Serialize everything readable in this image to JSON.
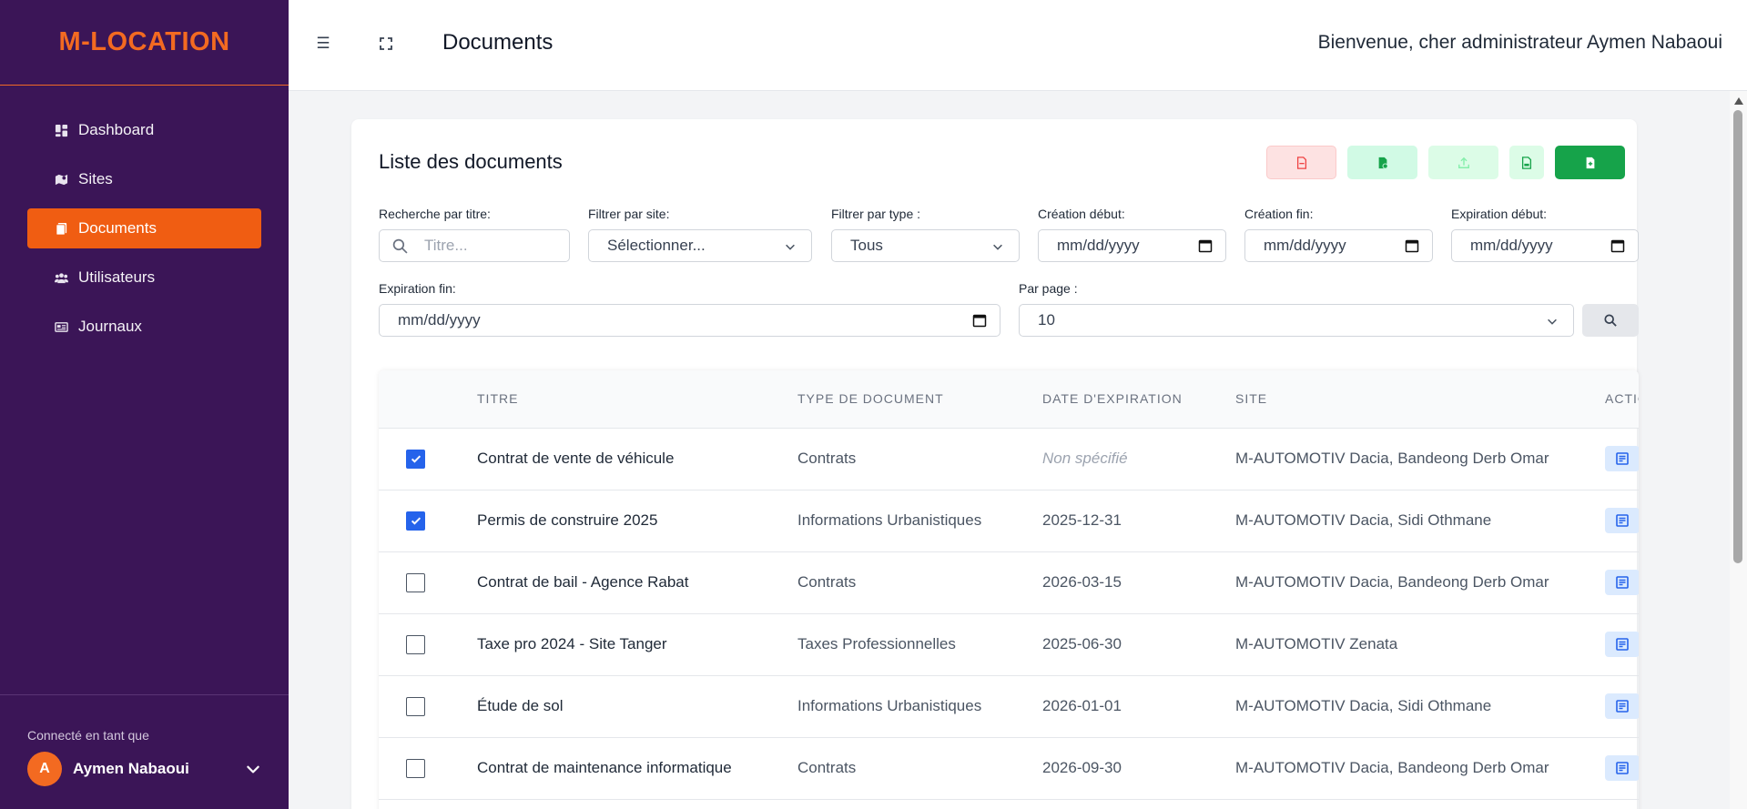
{
  "sidebar": {
    "brand": "M-LOCATION",
    "items": [
      {
        "label": "Dashboard",
        "icon": "dashboard-icon"
      },
      {
        "label": "Sites",
        "icon": "map-icon"
      },
      {
        "label": "Documents",
        "icon": "documents-icon",
        "active": true
      },
      {
        "label": "Utilisateurs",
        "icon": "users-icon"
      },
      {
        "label": "Journaux",
        "icon": "journal-icon"
      }
    ],
    "connected_label": "Connecté en tant que",
    "user_initial": "A",
    "user_name": "Aymen Nabaoui"
  },
  "header": {
    "menu_icon": "☰",
    "page_title": "Documents",
    "welcome": "Bienvenue, cher administrateur Aymen Nabaoui"
  },
  "card": {
    "title": "Liste des documents"
  },
  "filters": {
    "title_label": "Recherche par titre:",
    "title_placeholder": "Titre...",
    "site_label": "Filtrer par site:",
    "site_value": "Sélectionner...",
    "type_label": "Filtrer par type :",
    "type_value": "Tous",
    "creation_start_label": "Création début:",
    "creation_start_value": "mm/dd/yyyy",
    "creation_end_label": "Création fin:",
    "creation_end_value": "mm/dd/yyyy",
    "expiration_start_label": "Expiration début:",
    "expiration_start_value": "mm/dd/yyyy",
    "expiration_end_label": "Expiration fin:",
    "expiration_end_value": "mm/dd/yyyy",
    "per_page_label": "Par page :",
    "per_page_value": "10"
  },
  "table": {
    "columns": [
      "TITRE",
      "TYPE DE DOCUMENT",
      "DATE D'EXPIRATION",
      "SITE",
      "ACTIONS"
    ],
    "rows": [
      {
        "checked": true,
        "title": "Contrat de vente de véhicule",
        "type": "Contrats",
        "expiration": "Non spécifié",
        "site": "M-AUTOMOTIV Dacia, Bandeong Derb Omar"
      },
      {
        "checked": true,
        "title": "Permis de construire 2025",
        "type": "Informations Urbanistiques",
        "expiration": "2025-12-31",
        "site": "M-AUTOMOTIV Dacia, Sidi Othmane"
      },
      {
        "checked": false,
        "title": "Contrat de bail - Agence Rabat",
        "type": "Contrats",
        "expiration": "2026-03-15",
        "site": "M-AUTOMOTIV Dacia, Bandeong Derb Omar"
      },
      {
        "checked": false,
        "title": "Taxe pro 2024 - Site Tanger",
        "type": "Taxes Professionnelles",
        "expiration": "2025-06-30",
        "site": "M-AUTOMOTIV Zenata"
      },
      {
        "checked": false,
        "title": "Étude de sol",
        "type": "Informations Urbanistiques",
        "expiration": "2026-01-01",
        "site": "M-AUTOMOTIV Dacia, Sidi Othmane"
      },
      {
        "checked": false,
        "title": "Contrat de maintenance informatique",
        "type": "Contrats",
        "expiration": "2026-09-30",
        "site": "M-AUTOMOTIV Dacia, Bandeong Derb Omar"
      }
    ]
  },
  "colors": {
    "sidebar_bg": "#3b1557",
    "brand": "#f36a21",
    "active_item": "#f05d12",
    "primary_green": "#16a34a",
    "checkbox_blue": "#2563eb"
  }
}
